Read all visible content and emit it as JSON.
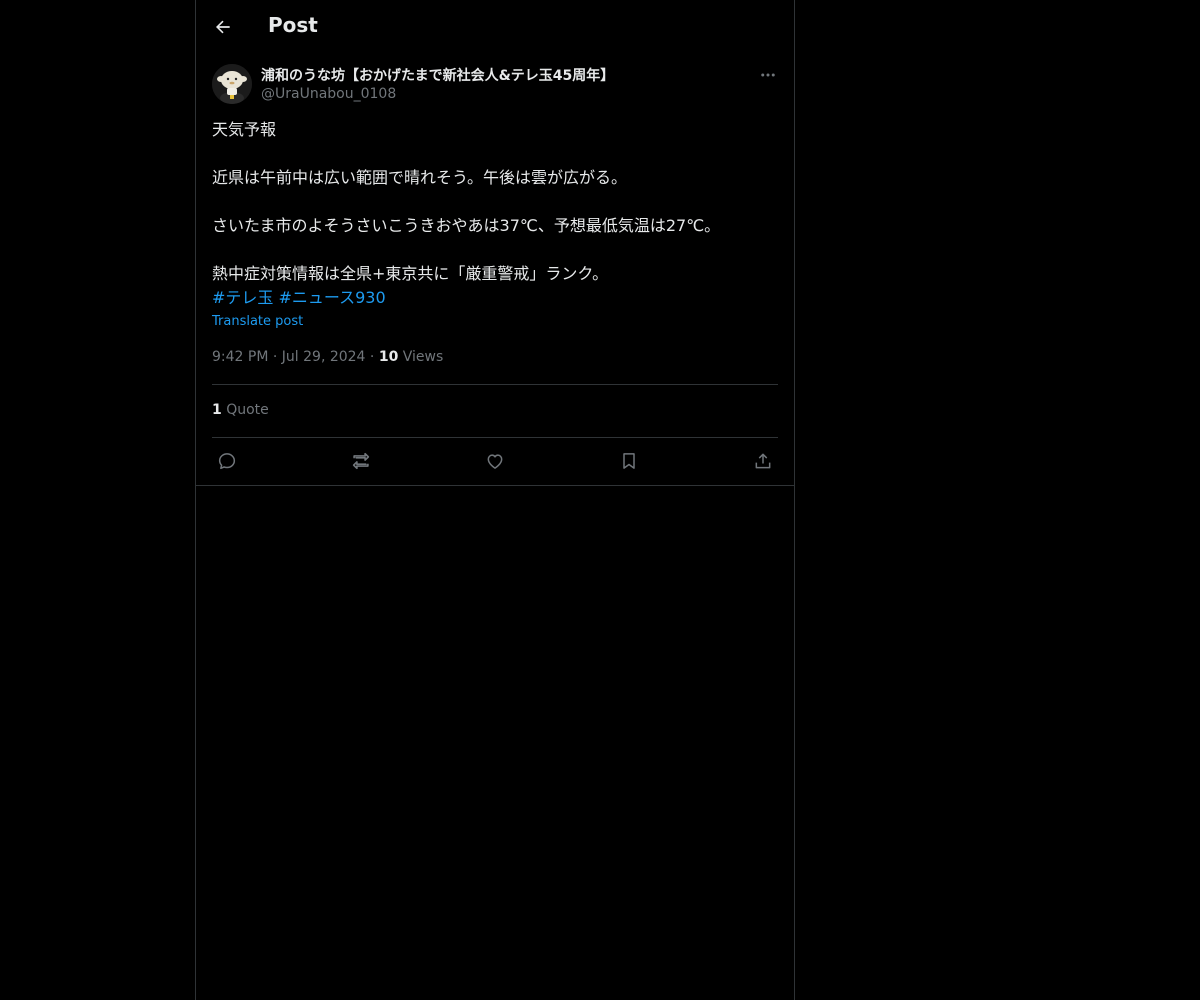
{
  "header": {
    "title": "Post"
  },
  "author": {
    "display_name": "浦和のうな坊【おかげたまで新社会人&テレ玉45周年】",
    "handle": "@UraUnabou_0108"
  },
  "post": {
    "lines": [
      "天気予報",
      "近県は午前中は広い範囲で晴れそう。午後は雲が広がる。",
      "さいたま市のよそうさいこうきおやあは37℃、予想最低気温は27℃。",
      "熱中症対策情報は全県+東京共に「厳重警戒」ランク。"
    ],
    "hashtags": [
      "#テレ玉",
      "#ニュース930"
    ],
    "translate_label": "Translate post"
  },
  "meta": {
    "time": "9:42 PM",
    "date": "Jul 29, 2024",
    "separator": "·",
    "views_count": "10",
    "views_label": "Views"
  },
  "engagement": {
    "quotes_count": "1",
    "quotes_label": "Quote"
  },
  "icons": {
    "back": "arrow-left-icon",
    "more": "more-horizontal-icon",
    "reply": "reply-icon",
    "repost": "repost-icon",
    "like": "heart-icon",
    "bookmark": "bookmark-icon",
    "share": "share-icon"
  },
  "colors": {
    "background": "#000000",
    "text": "#e7e9ea",
    "secondary": "#71767b",
    "accent": "#1d9bf0",
    "border": "#2f3336"
  }
}
